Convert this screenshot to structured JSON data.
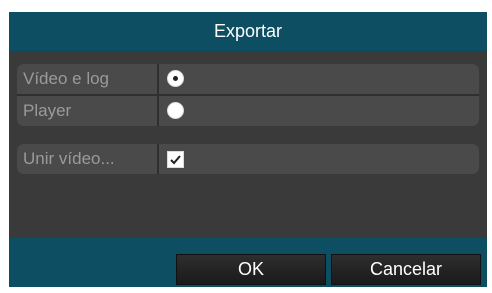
{
  "dialog": {
    "title": "Exportar",
    "options": [
      {
        "label": "Vídeo e log",
        "type": "radio",
        "selected": true
      },
      {
        "label": "Player",
        "type": "radio",
        "selected": false
      }
    ],
    "extra": {
      "label": "Unir vídeo...",
      "type": "checkbox",
      "checked": true
    },
    "ok_label": "OK",
    "cancel_label": "Cancelar"
  },
  "colors": {
    "titlebar": "#0d4e63",
    "panel": "#3a3a3a",
    "field": "#4a4a4a",
    "label_text": "#9a9a9a"
  }
}
